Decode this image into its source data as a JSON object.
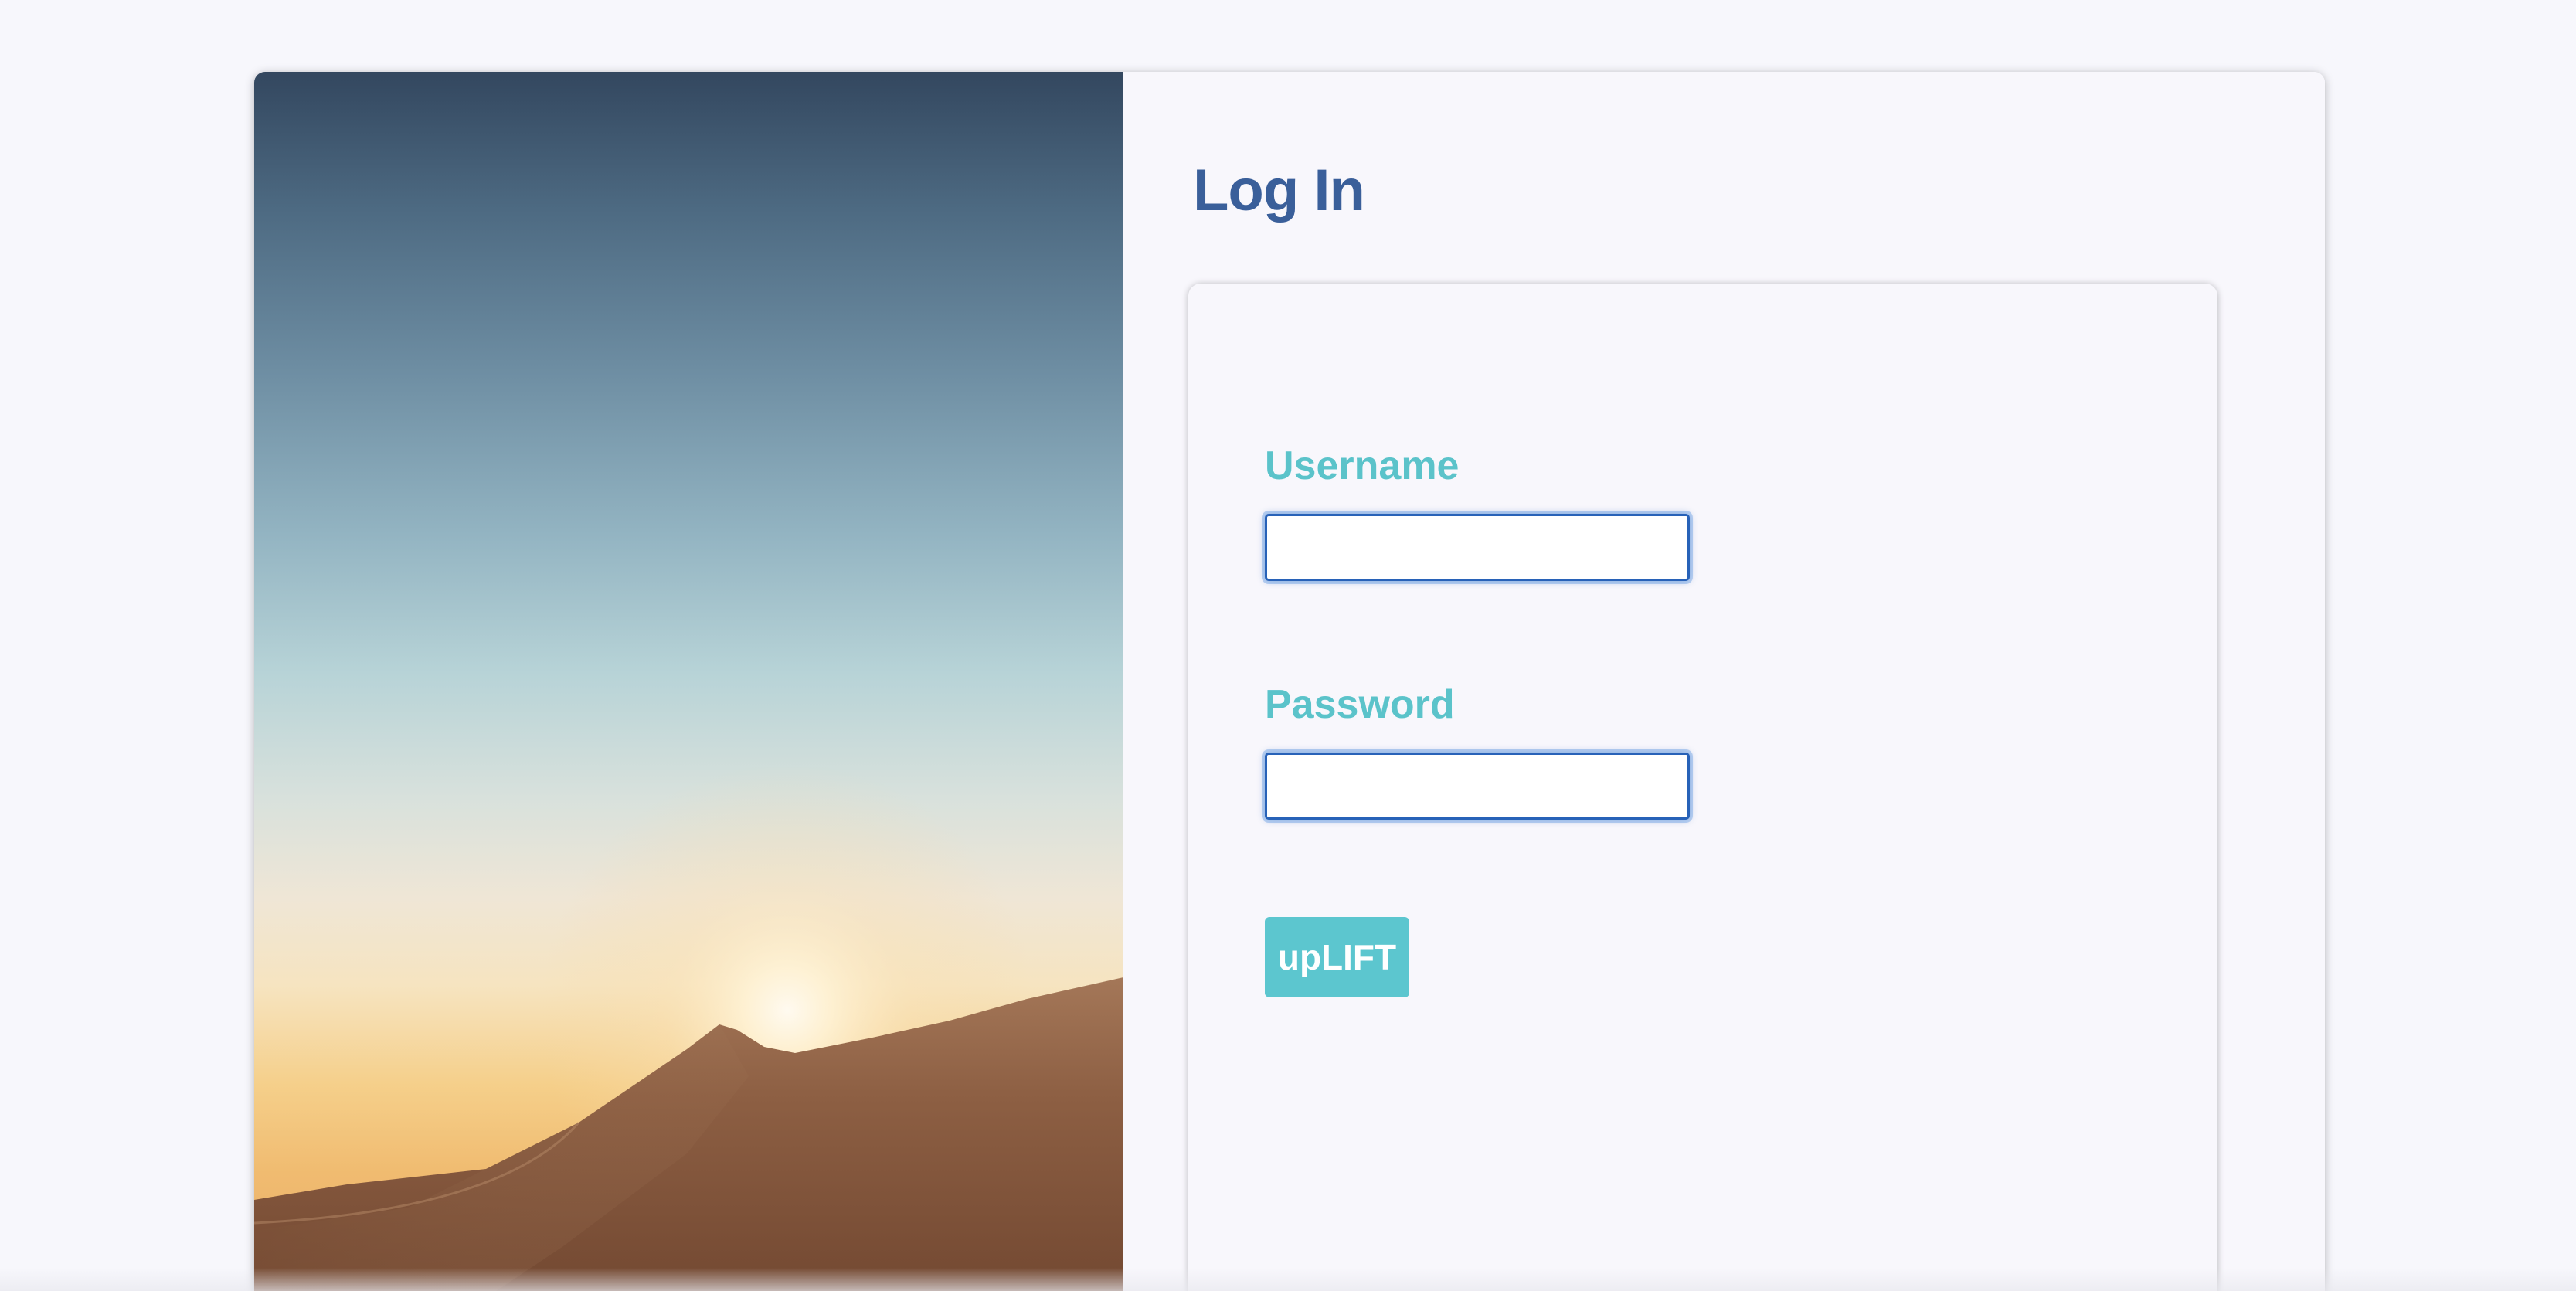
{
  "login": {
    "title": "Log In",
    "username_label": "Username",
    "username_value": "",
    "password_label": "Password",
    "password_value": "",
    "submit_label": "upLIFT"
  },
  "hero": {
    "description_icon": "desert-dune-sunset-photo"
  },
  "colors": {
    "page_background": "#f7f7fc",
    "title": "#3a5f9a",
    "label": "#5bc3ca",
    "button": "#5cc6cf",
    "input_focus_border": "#2862b8"
  }
}
